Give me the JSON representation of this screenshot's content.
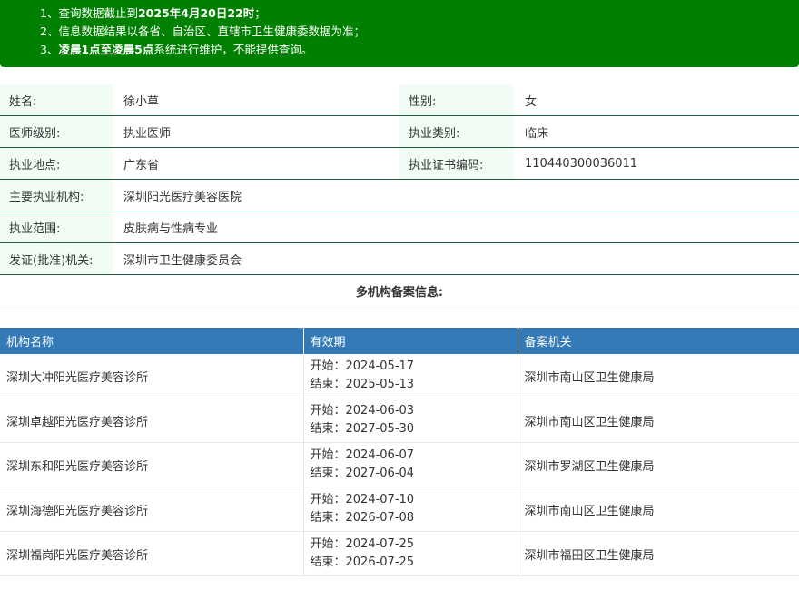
{
  "notice": {
    "line1_prefix": "1、查询数据截止到",
    "line1_bold": "2025年4月20日22时",
    "line1_suffix": "；",
    "line2": "2、信息数据结果以各省、自治区、直辖市卫生健康委数据为准；",
    "line3_prefix": "3、",
    "line3_bold": "凌晨1点至凌晨5点",
    "line3_suffix": "系统进行维护，不能提供查询。"
  },
  "info": {
    "name_label": "姓名:",
    "name": "徐小草",
    "gender_label": "性别:",
    "gender": "女",
    "level_label": "医师级别:",
    "level": "执业医师",
    "category_label": "执业类别:",
    "category": "临床",
    "location_label": "执业地点:",
    "location": "广东省",
    "cert_label": "执业证书编码:",
    "cert": "110440300036011",
    "institution_label": "主要执业机构:",
    "institution": "深圳阳光医疗美容医院",
    "scope_label": "执业范围:",
    "scope": "皮肤病与性病专业",
    "authority_label": "发证(批准)机关:",
    "authority": "深圳市卫生健康委员会"
  },
  "multi_title": "多机构备案信息:",
  "records": {
    "headers": [
      "机构名称",
      "有效期",
      "备案机关"
    ],
    "rows": [
      {
        "name": "深圳大冲阳光医疗美容诊所",
        "start": "开始：2024-05-17",
        "end": "结束：2025-05-13",
        "authority": "深圳市南山区卫生健康局"
      },
      {
        "name": "深圳卓越阳光医疗美容诊所",
        "start": "开始：2024-06-03",
        "end": "结束：2027-05-30",
        "authority": "深圳市南山区卫生健康局"
      },
      {
        "name": "深圳东和阳光医疗美容诊所",
        "start": "开始：2024-06-07",
        "end": "结束：2027-06-04",
        "authority": "深圳市罗湖区卫生健康局"
      },
      {
        "name": "深圳海德阳光医疗美容诊所",
        "start": "开始：2024-07-10",
        "end": "结束：2026-07-08",
        "authority": "深圳市南山区卫生健康局"
      },
      {
        "name": "深圳福岗阳光医疗美容诊所",
        "start": "开始：2024-07-25",
        "end": "结束：2026-07-25",
        "authority": "深圳市福田区卫生健康局"
      }
    ]
  }
}
